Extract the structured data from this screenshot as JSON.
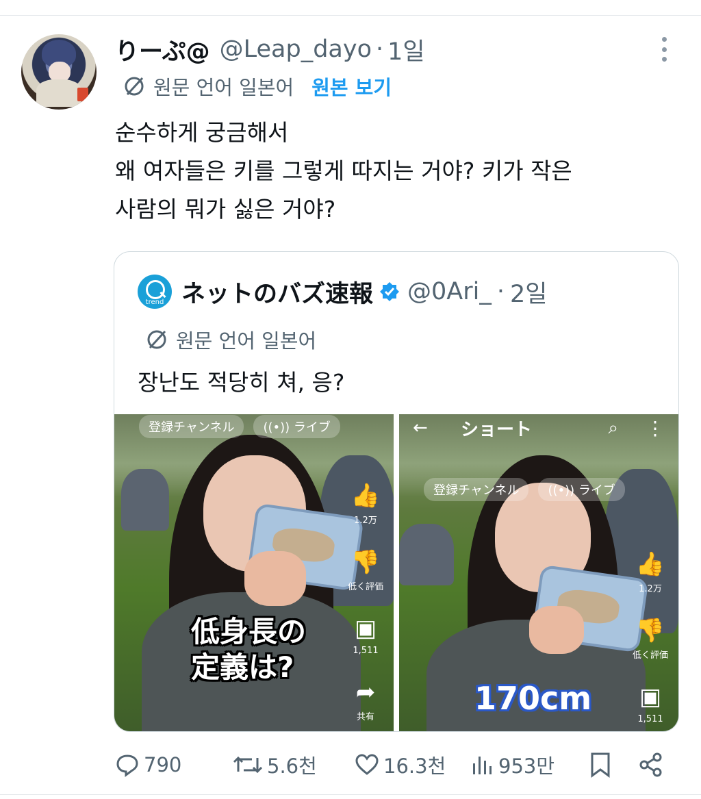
{
  "tweet": {
    "author_name": "りーぷ@",
    "handle": "@Leap_dayo",
    "separator": "·",
    "time": "1일",
    "translate_note": "원문 언어 일본어",
    "show_original": "원본 보기",
    "lines": [
      "순수하게 궁금해서",
      "왜 여자들은 키를 그렇게 따지는 거야? 키가 작은",
      "사람의 뭐가 싫은 거야?"
    ]
  },
  "quote": {
    "author_name": "ネットのバズ速報",
    "logo_text": "trend",
    "handle": "@0Ari_",
    "separator": "·",
    "time": "2일",
    "translate_note": "원문 언어 일본어",
    "text": "장난도 적당히 쳐, 응?"
  },
  "media_left": {
    "chip1": "登録チャンネル",
    "chip2": "((•)) ライブ",
    "like_count": "1.2万",
    "dislike_label": "低く評価",
    "comment_count": "1,511",
    "share_label": "共有",
    "caption_line1": "低身長の",
    "caption_line2": "定義は?"
  },
  "media_right": {
    "title": "ショート",
    "chip1": "登録チャンネル",
    "chip2": "((•)) ライブ",
    "like_count": "1.2万",
    "dislike_label": "低く評価",
    "comment_count": "1,511",
    "caption": "170cm"
  },
  "actions": {
    "replies": "790",
    "retweets": "5.6천",
    "likes": "16.3천",
    "views": "953만"
  },
  "colors": {
    "link": "#1d9bf0",
    "secondary_text": "#536471",
    "verified": "#1d9bf0"
  }
}
